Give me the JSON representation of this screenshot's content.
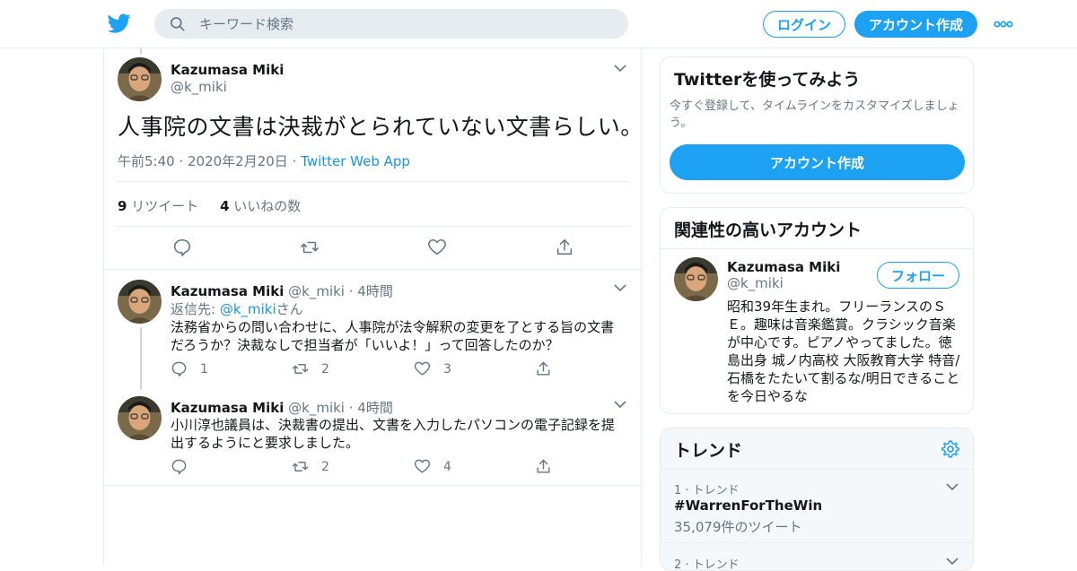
{
  "header": {
    "search_placeholder": "キーワード検索",
    "login_label": "ログイン",
    "signup_label": "アカウント作成",
    "brand_color": "#1da1f2"
  },
  "main_tweet": {
    "name": "Kazumasa Miki",
    "handle": "@k_miki",
    "text": "人事院の文書は決裁がとられていない文書らしい。",
    "timestamp": "午前5:40 · 2020年2月20日",
    "separator": "·",
    "source": "Twitter Web App",
    "retweet_count": "9",
    "retweet_label": "リツイート",
    "like_count": "4",
    "like_label": "いいねの数"
  },
  "replies": [
    {
      "name": "Kazumasa Miki",
      "handle": "@k_miki",
      "time": "· 4時間",
      "reply_to_prefix": "返信先: ",
      "reply_to_handle": "@k_miki",
      "reply_to_suffix": "さん",
      "text": "法務省からの問い合わせに、人事院が法令解釈の変更を了とする旨の文書だろうか？決裁なしで担当者が「いいよ！」って回答したのか？",
      "replies": "1",
      "retweets": "2",
      "likes": "3"
    },
    {
      "name": "Kazumasa Miki",
      "handle": "@k_miki",
      "time": "· 4時間",
      "text": "小川淳也議員は、決裁書の提出、文書を入力したパソコンの電子記録を提出するようにと要求しました。",
      "replies": "",
      "retweets": "2",
      "likes": "4"
    }
  ],
  "sidebar": {
    "signup_card": {
      "title": "Twitterを使ってみよう",
      "description": "今すぐ登録して、タイムラインをカスタマイズしましょう。",
      "button_label": "アカウント作成"
    },
    "related": {
      "title": "関連性の高いアカウント",
      "name": "Kazumasa Miki",
      "handle": "@k_miki",
      "follow_label": "フォロー",
      "bio": "昭和39年生まれ。フリーランスのＳＥ。趣味は音楽鑑賞。クラシック音楽が中心です。ピアノやってました。徳島出身 城ノ内高校 大阪教育大学 特音/石橋をたたいて割るな/明日できることを今日やるな"
    },
    "trends": {
      "title": "トレンド",
      "items": [
        {
          "rank": "1 · トレンド",
          "name": "#WarrenForTheWin",
          "count": "35,079件のツイート"
        },
        {
          "rank": "2 · トレンド"
        }
      ]
    }
  }
}
